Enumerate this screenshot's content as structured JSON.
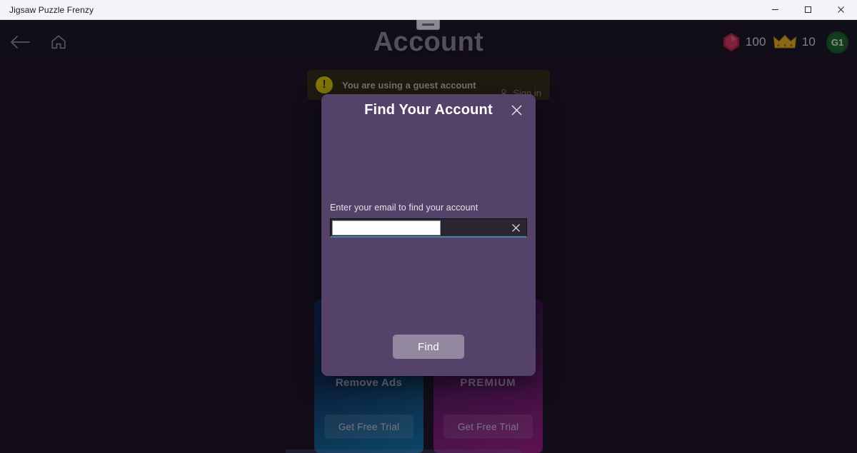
{
  "window": {
    "title": "Jigsaw Puzzle Frenzy",
    "minimize_label": "Minimize",
    "maximize_label": "Maximize",
    "close_label": "Close"
  },
  "header": {
    "title": "Account",
    "back_label": "Back",
    "home_label": "Home",
    "drag_handle_label": "Drag handle",
    "currency": {
      "gem_icon": "gem-icon",
      "gem_value": "100",
      "crown_icon": "crown-icon",
      "crown_value": "10",
      "gem_color": "#c21f47",
      "crown_color": "#e8b21d"
    },
    "avatar": {
      "initials": "G1",
      "color": "#1f6b2a"
    }
  },
  "banner": {
    "icon": "warning-icon",
    "icon_glyph": "!",
    "message": "You are using a guest account",
    "signin_icon": "person-icon",
    "signin_label": "Sign in",
    "background": "#332c12",
    "icon_color": "#d8c408"
  },
  "cards": [
    {
      "name": "remove-ads",
      "title": "Remove Ads",
      "button_label": "Get Free Trial",
      "accent": "#1275a8"
    },
    {
      "name": "premium",
      "title": "PREMIUM",
      "button_label": "Get Free Trial",
      "accent": "#9b1d84"
    }
  ],
  "modal": {
    "title": "Find Your Account",
    "close_icon": "close-icon",
    "close_label": "Close dialog",
    "field_label": "Enter your email to find your account",
    "email_value": "",
    "email_placeholder": "",
    "clear_icon": "close-icon",
    "clear_label": "Clear",
    "submit_label": "Find",
    "background": "#554269",
    "underline_color": "#3f8aa3",
    "submit_color": "#9289a0"
  }
}
